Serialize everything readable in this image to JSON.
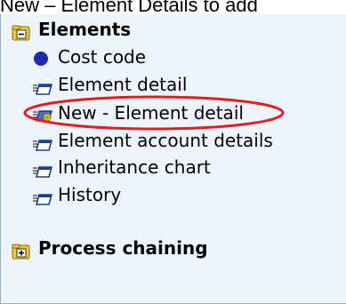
{
  "caption": {
    "text": "New – Element Details to add"
  },
  "colors": {
    "panel_bg": "#eef4fc",
    "highlight": "#e02020",
    "folder": "#f2c830",
    "dot": "#1d2bb0"
  },
  "tree": {
    "elements": {
      "label": "Elements",
      "icon": "folder-minus-icon",
      "children": [
        {
          "label": "Cost code",
          "icon": "blue-dot-icon"
        },
        {
          "label": "Element detail",
          "icon": "form-icon"
        },
        {
          "label": "New - Element detail",
          "icon": "new-form-icon",
          "highlighted": true
        },
        {
          "label": "Element account details",
          "icon": "form-icon"
        },
        {
          "label": "Inheritance chart",
          "icon": "form-icon"
        },
        {
          "label": "History",
          "icon": "form-icon"
        }
      ]
    },
    "process_chaining": {
      "label": "Process chaining",
      "icon": "folder-plus-icon"
    }
  }
}
